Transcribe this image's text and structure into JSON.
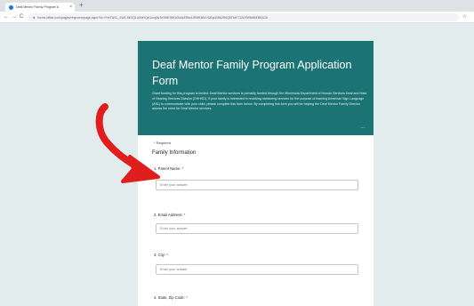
{
  "browser": {
    "tab_title": "Deaf Mentor Family Program A",
    "tab_close": "×",
    "newtab_icon": "+",
    "back_icon": "←",
    "forward_icon": "→",
    "reload_icon": "C",
    "url": "forms.office.com/pages/responsepage.aspx?id=YHnTUSL_EUE-5E0QLvDNHQxUuxg0vTeSME9IH1t3d4sERtc9JRBH3B1VUEpUMlk2R0Q5TldKT1ZLRWNMM3BDUA",
    "star_icon": "☆"
  },
  "form": {
    "title": "Deaf Mentor Family Program Application Form",
    "description": "Grant funding for this program is limited. Deaf Mentor services is primarily funded through the Minnesota Department of Human Services Deaf and Hard of Hearing Services Division (DHHSD). If your family is interested in receiving mentoring services for the purpose of learning American Sign Language (ASL) to communicate with your child, please complete this form below. By completing this form you will be helping the Deaf Mentor Family Director assess the need for Deaf Mentor services.",
    "header_dots": "...",
    "required_note_ast": "*",
    "required_note": "Required",
    "section_title": "Family Information",
    "questions": [
      {
        "label": "1. Parent Name:",
        "ast": "*",
        "placeholder": "Enter your answer"
      },
      {
        "label": "2. Email Address:",
        "ast": "*",
        "placeholder": "Enter your answer"
      },
      {
        "label": "3. City:",
        "ast": "*",
        "placeholder": "Enter your answer"
      },
      {
        "label": "4. State, Zip Code:",
        "ast": "*"
      }
    ]
  },
  "colors": {
    "header": "#1c7373",
    "page_bg": "#e2ecec",
    "arrow": "#e01e1e"
  }
}
